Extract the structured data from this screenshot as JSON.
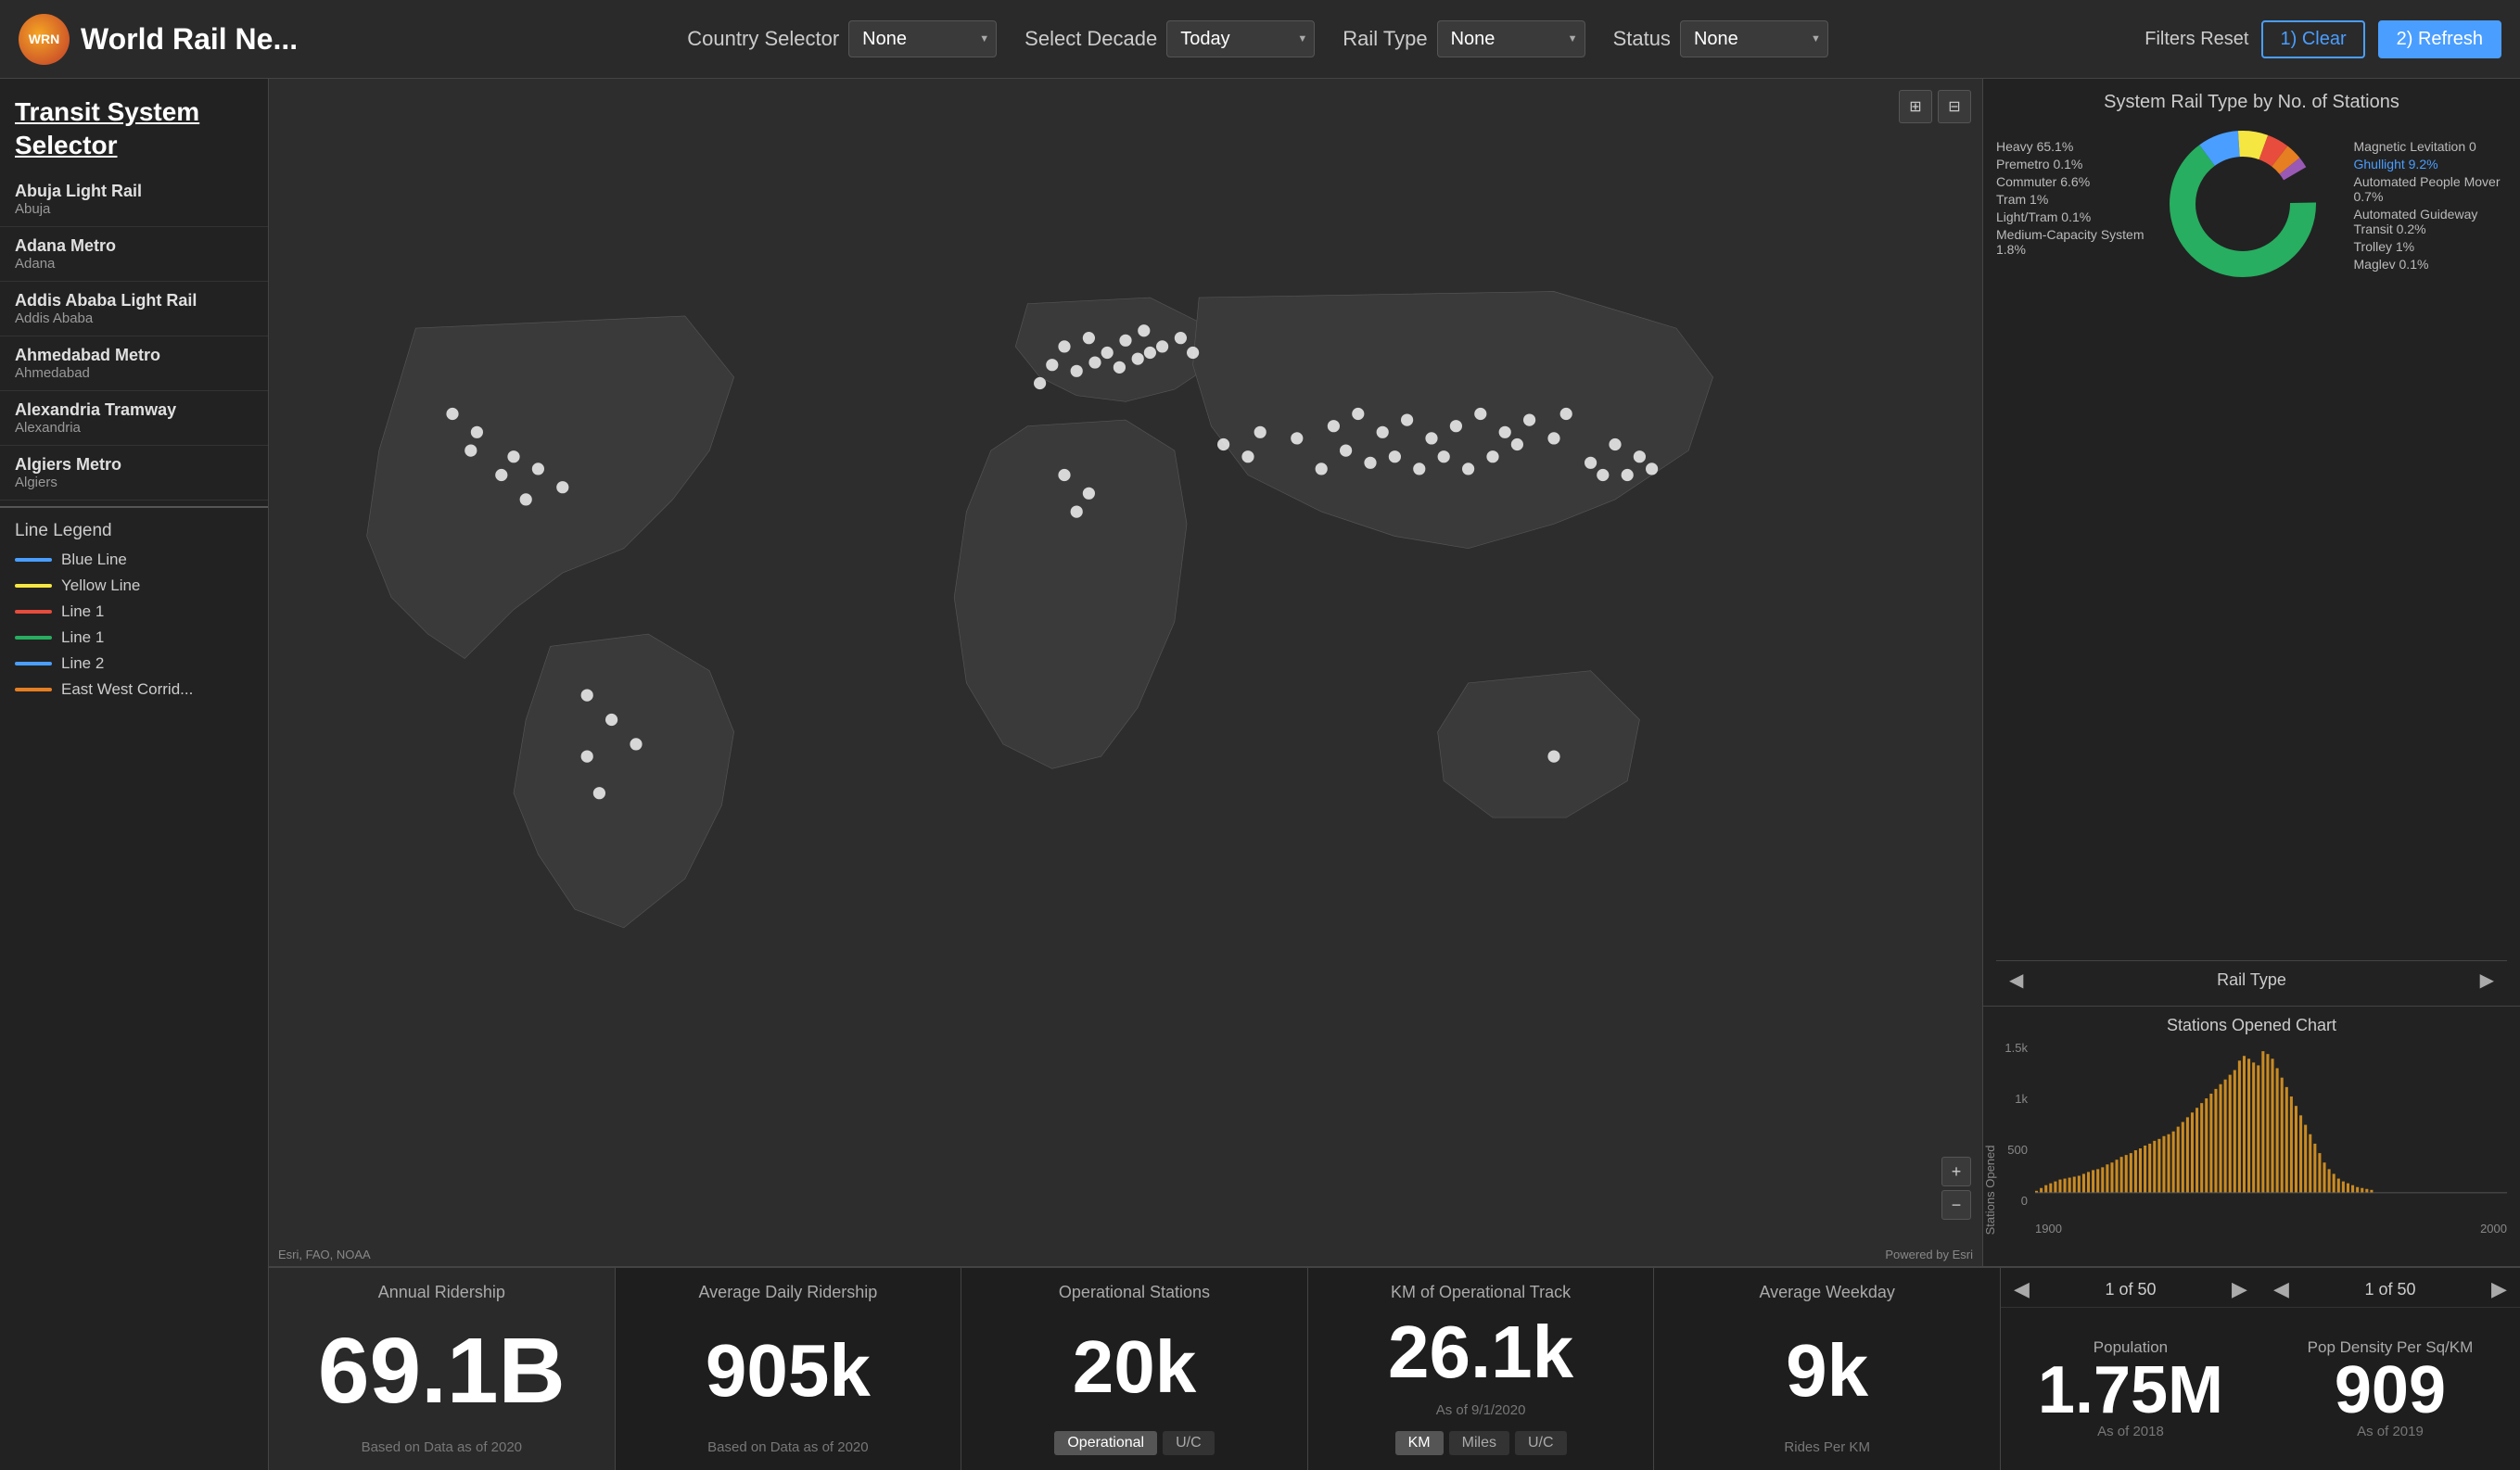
{
  "app": {
    "logo_text": "WRN",
    "title": "World Rail Ne..."
  },
  "header": {
    "country_selector_label": "Country Selector",
    "country_value": "None",
    "decade_label": "Select Decade",
    "decade_value": "Today",
    "rail_type_label": "Rail Type",
    "rail_type_value": "None",
    "status_label": "Status",
    "status_value": "None",
    "filters_reset_label": "Filters Reset",
    "btn_clear": "1) Clear",
    "btn_refresh": "2) Refresh"
  },
  "sidebar": {
    "title": "Transit System Selector",
    "transit_items": [
      {
        "name": "Abuja Light Rail",
        "city": "Abuja"
      },
      {
        "name": "Adana Metro",
        "city": "Adana"
      },
      {
        "name": "Addis Ababa Light Rail",
        "city": "Addis Ababa"
      },
      {
        "name": "Ahmedabad Metro",
        "city": "Ahmedabad"
      },
      {
        "name": "Alexandria Tramway",
        "city": "Alexandria"
      },
      {
        "name": "Algiers Metro",
        "city": "Algiers"
      }
    ],
    "legend_title": "Line Legend",
    "legend_items": [
      {
        "label": "Blue Line",
        "color": "#4a9eff"
      },
      {
        "label": "Yellow Line",
        "color": "#f5e642"
      },
      {
        "label": "Line 1",
        "color": "#e74c3c"
      },
      {
        "label": "Line 1",
        "color": "#27ae60"
      },
      {
        "label": "Line 2",
        "color": "#4a9eff"
      },
      {
        "label": "East West Corrid...",
        "color": "#e67e22"
      }
    ]
  },
  "map": {
    "attribution": "Esri, FAO, NOAA",
    "powered": "Powered by Esri"
  },
  "right_panel": {
    "rail_type_title": "System Rail Type by No. of Stations",
    "pie_labels_left": [
      "Heavy 65.1%",
      "Premetro 0.1%",
      "Commuter 6.6%",
      "Tram 1%",
      "Light/Tram 0.1%",
      "Medium-Capacity System 1.8%"
    ],
    "pie_labels_right": [
      "Magnetic Levitation 0",
      "Ghullight 9.2%",
      "Automated People Mover 0.7%",
      "Automated Guideway Transit 0.2%",
      "Trolley 1%",
      "Maglev 0.1%"
    ],
    "rail_nav_label": "Rail Type",
    "stations_chart_title": "Stations Opened Chart",
    "chart_y_label": "Stations Opened",
    "chart_x_1900": "1900",
    "chart_x_2000": "2000",
    "chart_y_ticks": [
      "1.5k",
      "1k",
      "500",
      "0"
    ]
  },
  "bottom": {
    "annual_ridership_label": "Annual Ridership",
    "annual_ridership_value": "69.1B",
    "annual_ridership_sublabel": "Based on Data as of 2020",
    "avg_daily_label": "Average Daily Ridership",
    "avg_daily_value": "905k",
    "avg_daily_sublabel": "Based on Data as of 2020",
    "operational_stations_label": "Operational Stations",
    "operational_stations_value": "20k",
    "op_tab": "Operational",
    "uc_tab": "U/C",
    "km_track_label": "KM of Operational Track",
    "km_track_value": "26.1k",
    "km_track_date": "As of 9/1/2020",
    "km_tab": "KM",
    "miles_tab": "Miles",
    "uc_tab2": "U/C",
    "avg_weekday_label": "Average Weekday",
    "avg_weekday_value": "9k",
    "avg_weekday_sublabel": "Rides Per KM",
    "pop_nav_label1": "1 of 50",
    "pop_nav_label2": "1 of 50",
    "pop_sublabel": "Population",
    "pop_value": "1.75M",
    "pop_date": "As of 2018",
    "pop_density_sublabel": "Pop Density Per Sq/KM",
    "pop_density_value": "909",
    "pop_density_date": "As of 2019"
  }
}
